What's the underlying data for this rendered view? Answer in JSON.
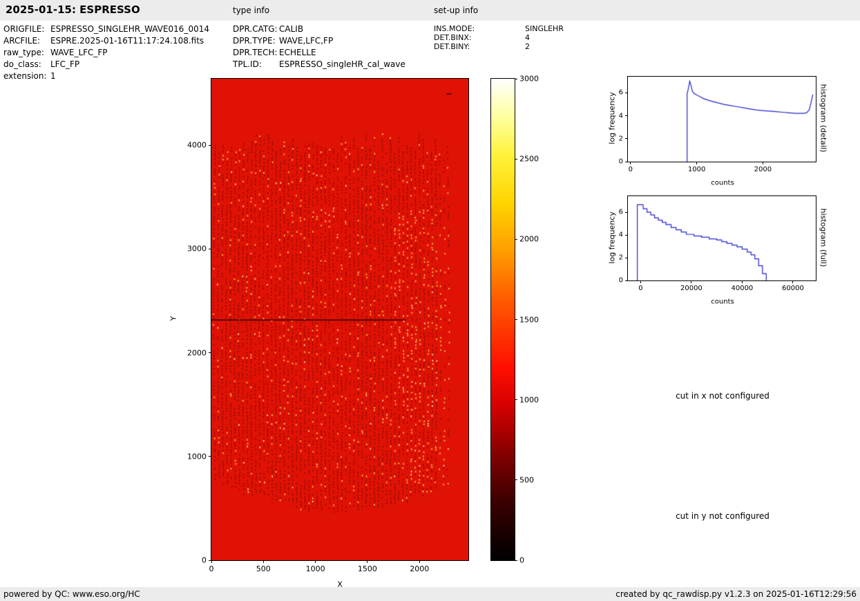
{
  "header": {
    "title": "2025-01-15: ESPRESSO",
    "type_info_label": "type info",
    "setup_info_label": "set-up info"
  },
  "file_info": {
    "rows": [
      {
        "label": "ORIGFILE:",
        "value": "ESPRESSO_SINGLEHR_WAVE016_0014"
      },
      {
        "label": "ARCFILE:",
        "value": "ESPRE.2025-01-16T11:17:24.108.fits"
      },
      {
        "label": "raw_type:",
        "value": "WAVE_LFC_FP"
      },
      {
        "label": "do_class:",
        "value": "LFC_FP"
      },
      {
        "label": "extension:",
        "value": "1"
      }
    ]
  },
  "type_info": {
    "rows": [
      {
        "label": "DPR.CATG:",
        "value": "CALIB"
      },
      {
        "label": "DPR.TYPE:",
        "value": "WAVE,LFC,FP"
      },
      {
        "label": "DPR.TECH:",
        "value": "ECHELLE"
      },
      {
        "label": "TPL.ID:",
        "value": "ESPRESSO_singleHR_cal_wave"
      }
    ]
  },
  "setup_info": {
    "rows": [
      {
        "label": "INS.MODE:",
        "value": "SINGLEHR"
      },
      {
        "label": "DET.BINX:",
        "value": "4"
      },
      {
        "label": "DET.BINY:",
        "value": "2"
      }
    ]
  },
  "messages": {
    "cut_x": "cut in x not configured",
    "cut_y": "cut in y not configured"
  },
  "footer": {
    "left": "powered by QC: www.eso.org/HC",
    "right": "created by qc_rawdisp.py v1.2.3 on 2025-01-16T12:29:56"
  },
  "chart_data": [
    {
      "type": "heatmap",
      "name": "raw-frame",
      "title": "",
      "xlabel": "X",
      "ylabel": "Y",
      "xlim": [
        0,
        2470
      ],
      "ylim": [
        0,
        4640
      ],
      "xticks": [
        0,
        500,
        1000,
        1500,
        2000
      ],
      "yticks": [
        0,
        1000,
        2000,
        3000,
        4000
      ],
      "colormap": "hot",
      "background_value_color": "#e01205",
      "stripe_dark_color": "#8e0b00",
      "stripe_bright_color": "#ffd84e",
      "colorbar": {
        "range": [
          0,
          3000
        ],
        "ticks": [
          0,
          500,
          1000,
          1500,
          2000,
          2500,
          3000
        ]
      },
      "description": "Raw ESPRESSO LFC/FP echelle frame: bright red background with dense vertical dotted echelle-order stripes (dark red with yellow speckles) spanning Y about 500 to 4100, brighter yellow speckle clump near X 1800-2250, dark horizontal artifact line at Y about 2320 from X=0 to X about 1870, small dark blemish near top right."
    },
    {
      "type": "line",
      "name": "histogram-detail",
      "title": "",
      "xlabel": "counts",
      "ylabel": "log frequency",
      "right_label": "histogram (detail)",
      "xlim": [
        -40,
        2800
      ],
      "ylim": [
        0,
        7.4
      ],
      "xticks": [
        0,
        1000,
        2000
      ],
      "yticks": [
        0,
        2,
        4,
        6
      ],
      "grid": false,
      "line_color": "#2323cc",
      "series": [
        {
          "name": "histogram",
          "x": [
            855,
            855,
            875,
            895,
            915,
            935,
            955,
            1000,
            1050,
            1100,
            1200,
            1300,
            1400,
            1500,
            1600,
            1700,
            1800,
            1900,
            2000,
            2100,
            2200,
            2300,
            2400,
            2500,
            2600,
            2660,
            2700,
            2730,
            2755
          ],
          "y": [
            0,
            5.9,
            6.4,
            7.0,
            6.6,
            6.15,
            5.95,
            5.8,
            5.65,
            5.5,
            5.3,
            5.15,
            5.0,
            4.9,
            4.8,
            4.7,
            4.6,
            4.5,
            4.45,
            4.4,
            4.35,
            4.3,
            4.25,
            4.2,
            4.2,
            4.25,
            4.5,
            5.2,
            5.85
          ]
        }
      ]
    },
    {
      "type": "line",
      "name": "histogram-full",
      "title": "",
      "xlabel": "counts",
      "ylabel": "log frequency",
      "right_label": "histogram (full)",
      "xlim": [
        -5000,
        69000
      ],
      "ylim": [
        0,
        7.4
      ],
      "xticks": [
        0,
        20000,
        40000,
        60000
      ],
      "yticks": [
        0,
        2,
        4,
        6
      ],
      "grid": false,
      "line_color": "#2323cc",
      "series": [
        {
          "name": "histogram",
          "x": [
            -1300,
            -1300,
            1000,
            1000,
            2500,
            2500,
            4000,
            4000,
            5500,
            5500,
            7000,
            7000,
            8500,
            8500,
            10000,
            10000,
            12000,
            12000,
            14000,
            14000,
            16000,
            16000,
            18000,
            18000,
            21000,
            21000,
            24000,
            24000,
            27000,
            27000,
            30000,
            30000,
            32000,
            32000,
            34000,
            34000,
            36000,
            36000,
            38000,
            38000,
            40000,
            40000,
            42000,
            42000,
            43500,
            43500,
            45000,
            45000,
            46500,
            46500,
            48000,
            48000,
            49500,
            49500
          ],
          "y": [
            0,
            6.65,
            6.65,
            6.3,
            6.3,
            6.0,
            6.0,
            5.75,
            5.75,
            5.5,
            5.5,
            5.3,
            5.3,
            5.1,
            5.1,
            4.9,
            4.9,
            4.65,
            4.65,
            4.45,
            4.45,
            4.25,
            4.25,
            4.05,
            4.05,
            3.9,
            3.9,
            3.8,
            3.8,
            3.65,
            3.65,
            3.55,
            3.55,
            3.4,
            3.4,
            3.25,
            3.25,
            3.1,
            3.1,
            2.95,
            2.95,
            2.75,
            2.75,
            2.5,
            2.5,
            2.25,
            2.25,
            1.9,
            1.9,
            1.3,
            1.3,
            0.6,
            0.6,
            0
          ]
        }
      ]
    }
  ]
}
